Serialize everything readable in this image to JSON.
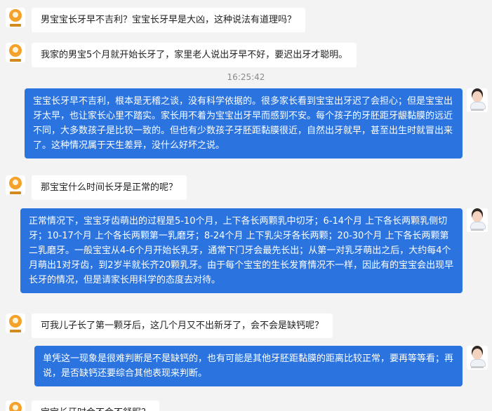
{
  "conversation": {
    "messages": [
      {
        "sender": "user",
        "text": "男宝宝长牙早不吉利？宝宝长牙早是大凶，这种说法有道理吗？"
      },
      {
        "sender": "user",
        "text": "我家的男宝5个月就开始长牙了，家里老人说出牙早不好，要迟出牙才聪明。"
      },
      {
        "sender": "doctor",
        "text": "宝宝长牙早不吉利，根本是无稽之谈，没有科学依据的。很多家长看到宝宝出牙迟了会担心；但是宝宝出牙太早，也让家长心里不踏实。家长用不着为宝宝出牙早而感到不安。每个孩子的牙胚距牙龈黏膜的远近不同，大多数孩子是比较一致的。但也有少数孩子牙胚距黏膜很近，自然出牙就早，甚至出生时就冒出来了。这种情况属于天生差异，没什么好坏之说。"
      },
      {
        "sender": "user",
        "text": "那宝宝什么时间长牙是正常的呢？"
      },
      {
        "sender": "doctor",
        "text": "正常情况下，宝宝牙齿萌出的过程是5-10个月，上下各长两颗乳中切牙；6-14个月 上下各长两颗乳侧切牙；10-17个月 上个各长两颗第一乳磨牙；8-24个月 上下乳尖牙各长两颗；20-30个月 上下各长两颗第二乳磨牙。一般宝宝从4-6个月开始长乳牙，通常下门牙会最先长出；从第一对乳牙萌出之后，大约每4个月萌出1对牙齿，到2岁半就长齐20颗乳牙。由于每个宝宝的生长发育情况不一样，因此有的宝宝会出现早长牙的情况，但是请家长用科学的态度去对待。"
      },
      {
        "sender": "user",
        "text": "可我儿子长了第一颗牙后，这几个月又不出新牙了，会不会是缺钙呢？"
      },
      {
        "sender": "doctor",
        "text": "单凭这一现象是很难判断是不是缺钙的，也有可能是其他牙胚距黏膜的距离比较正常，要再等等看；再说，是否缺钙还要综合其他表现来判断。"
      },
      {
        "sender": "user",
        "text": "宝宝长牙时会不会不舒服？"
      }
    ],
    "timestamp": "16:25:42"
  },
  "colors": {
    "background": "#f3f3f3",
    "user_bubble": "#ffffff",
    "doctor_bubble": "#2b74e0"
  },
  "icons": {
    "user_avatar": "user-avatar-icon",
    "doctor_avatar": "doctor-avatar-icon"
  }
}
